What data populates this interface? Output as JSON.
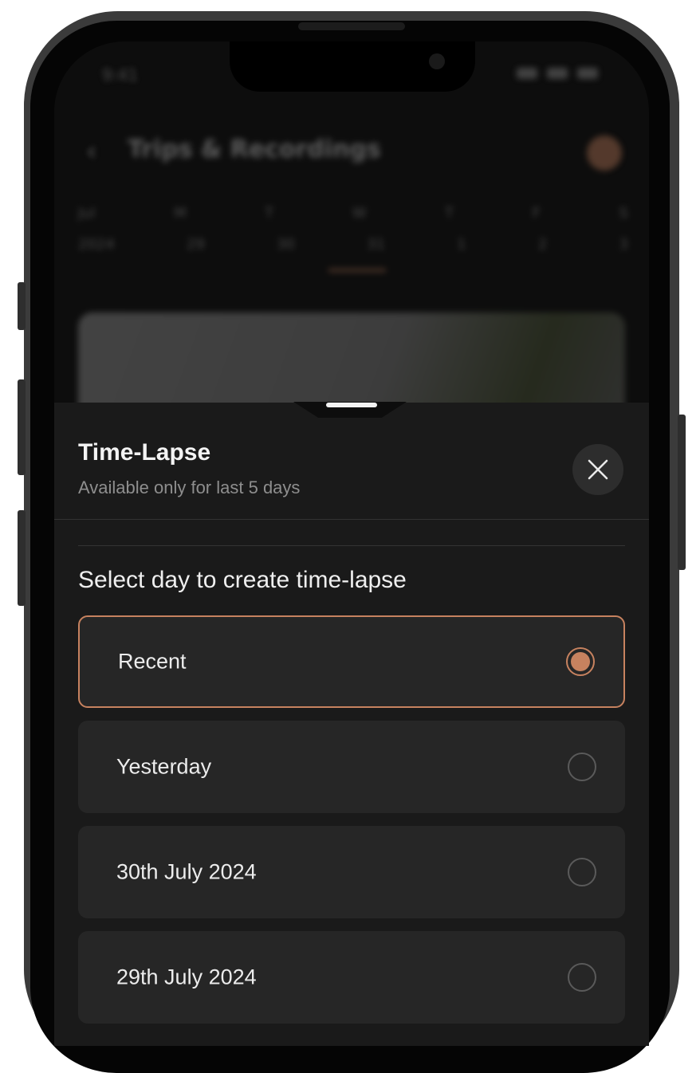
{
  "background_app": {
    "status_time": "9:41",
    "title": "Trips & Recordings",
    "calendar": {
      "month": "Jul",
      "year": "2024",
      "day_letters": [
        "M",
        "T",
        "W",
        "T",
        "F",
        "S"
      ],
      "day_numbers": [
        "29",
        "30",
        "31",
        "1",
        "2",
        "3"
      ]
    }
  },
  "sheet": {
    "title": "Time-Lapse",
    "subtitle": "Available only for last 5 days",
    "section_title": "Select day to create time-lapse",
    "options": [
      {
        "label": "Recent",
        "selected": true
      },
      {
        "label": "Yesterday",
        "selected": false
      },
      {
        "label": "30th July 2024",
        "selected": false
      },
      {
        "label": "29th July 2024",
        "selected": false
      }
    ]
  },
  "colors": {
    "accent": "#c7825f",
    "sheet_background": "#1a1a1a",
    "option_background": "#262626"
  },
  "icons": {
    "close": "close-icon",
    "back": "chevron-left-icon"
  }
}
